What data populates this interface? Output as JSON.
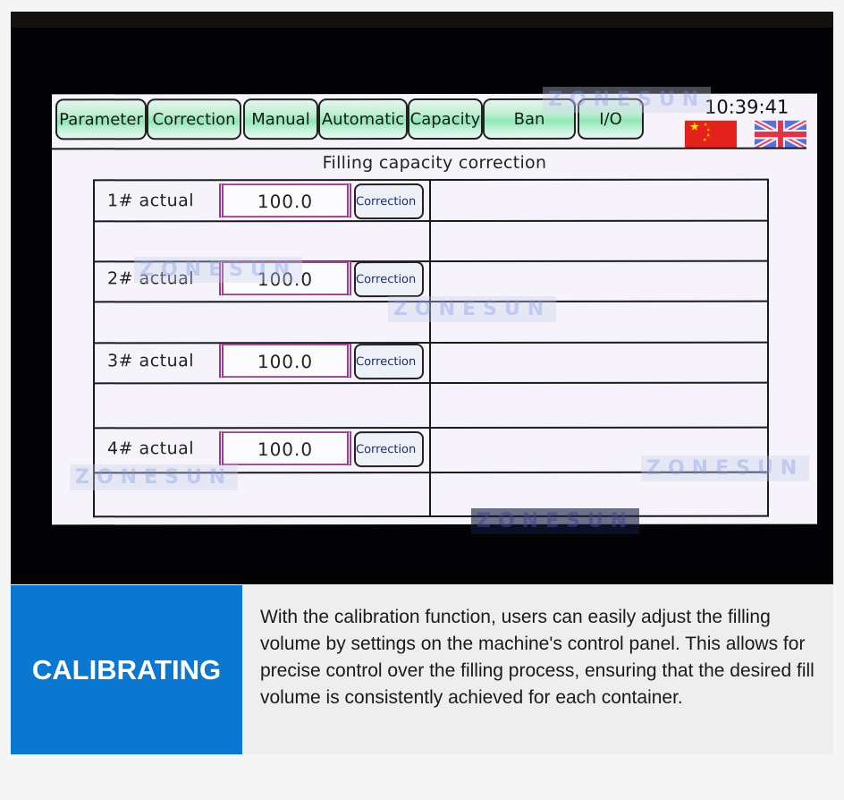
{
  "hmi": {
    "tabs": [
      {
        "label": "Parameter"
      },
      {
        "label": "Correction"
      },
      {
        "label": "Manual"
      },
      {
        "label": "Automatic"
      },
      {
        "label": "Capacity"
      },
      {
        "label": "Ban"
      },
      {
        "label": "I/O"
      }
    ],
    "clock": "10:39:41",
    "languages": [
      {
        "name": "Chinese",
        "icon": "china-flag-icon"
      },
      {
        "name": "English",
        "icon": "uk-flag-icon"
      }
    ],
    "page_title": "Filling capacity correction",
    "rows": [
      {
        "label": "1# actual",
        "value": "100.0",
        "button": "Correction"
      },
      {
        "label": "2# actual",
        "value": "100.0",
        "button": "Correction"
      },
      {
        "label": "3# actual",
        "value": "100.0",
        "button": "Correction"
      },
      {
        "label": "4# actual",
        "value": "100.0",
        "button": "Correction"
      }
    ]
  },
  "watermark": "ZONESUN",
  "banner": {
    "heading": "CALIBRATING",
    "description": "With the calibration function, users can easily adjust the filling volume by settings on the machine's control panel. This allows for precise control over the filling process, ensuring that the desired fill volume is consistently achieved for each container.",
    "accent_color": "#0a78d1"
  }
}
